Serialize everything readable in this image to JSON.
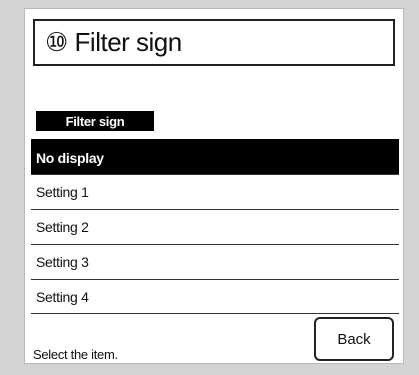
{
  "header": {
    "title": "⑩ Filter sign"
  },
  "section": {
    "label": "Filter sign"
  },
  "options": [
    {
      "label": "No display",
      "selected": true
    },
    {
      "label": "Setting 1",
      "selected": false
    },
    {
      "label": "Setting 2",
      "selected": false
    },
    {
      "label": "Setting 3",
      "selected": false
    },
    {
      "label": "Setting 4",
      "selected": false
    }
  ],
  "footer": {
    "status": "Select the item.",
    "back_label": "Back"
  }
}
